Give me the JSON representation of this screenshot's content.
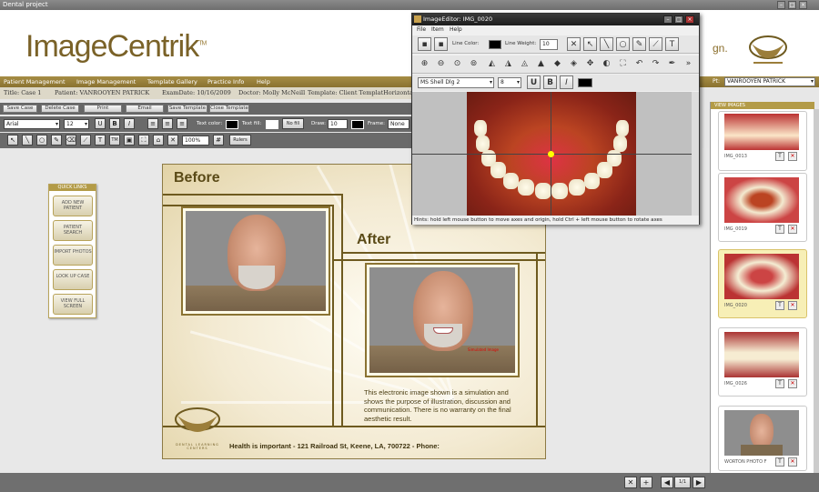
{
  "window": {
    "title": "Dental project"
  },
  "brand": {
    "logo_text": "ImageCentrik",
    "logo_tm": "TM",
    "tagline_fragment": "gn."
  },
  "nav": {
    "items": [
      "Patient Management",
      "Image Management",
      "Template Gallery",
      "Practice Info",
      "Help"
    ],
    "patient_search_label": "Pt:",
    "patient_search_value": "VANROOYEN PATRICK"
  },
  "info": {
    "title": "Title: Case 1",
    "patient": "Patient: VANROOYEN PATRICK",
    "exam_date": "ExamDate: 10/16/2009",
    "doctor": "Doctor: Molly McNeill",
    "template": "Template: Client TemplatHorizontal"
  },
  "actions": [
    "Save Case",
    "Delete Case",
    "Print",
    "Email",
    "Save Template",
    "Close Template"
  ],
  "format_toolbar": {
    "font": "Arial",
    "size": "12",
    "bold": "B",
    "underline": "U",
    "italic": "I",
    "text_color_label": "Text color:",
    "text_fill_label": "Text fill:",
    "no_fill": "No fill",
    "draw_label": "Draw:",
    "draw_size": "10",
    "frame_label": "Frame:",
    "frame_value": "None"
  },
  "tools_toolbar": {
    "zoom": "100%",
    "rulers": "Rulers"
  },
  "quick_links": {
    "title": "QUICK LINKS",
    "items": [
      "ADD NEW PATIENT",
      "PATIENT SEARCH",
      "IMPORT PHOTOS",
      "LOOK UP CASE",
      "VIEW FULL SCREEN"
    ]
  },
  "template": {
    "before": "Before",
    "after": "After",
    "watermark": "Simulated Image",
    "disclaimer": "This electronic image shown is a simulation and shows the purpose of illustration, discussion and communication. There is no warranty on the final aesthetic result.",
    "footer": "Health is important - 121 Railroad St, Keene, LA, 700722 - Phone:",
    "logo_caption": "DENTAL LEARNING CENTERS"
  },
  "right_panel": {
    "title": "VIEW IMAGES",
    "thumbs": [
      {
        "name": "IMG_0013"
      },
      {
        "name": "IMG_0019"
      },
      {
        "name": "IMG_0020"
      },
      {
        "name": "IMG_0026"
      },
      {
        "name": "WORTON PHOTO F"
      }
    ],
    "btn_t": "T",
    "btn_x": "✕"
  },
  "status": {
    "page": "1/1"
  },
  "editor": {
    "title": "ImageEditor: IMG_0020",
    "menu": [
      "File",
      "Item",
      "Help"
    ],
    "line_color_label": "Line Color:",
    "line_weight_label": "Line Weight:",
    "line_weight": "10",
    "font": "MS Shell Dlg 2",
    "font_size": "8",
    "status_text": "Hints: hold left mouse button to move axes and origin, hold Ctrl + left mouse button to rotate axes"
  },
  "colors": {
    "gold": "#9b7e3a",
    "nav": "#8a7230",
    "accent": "#b39b47"
  }
}
